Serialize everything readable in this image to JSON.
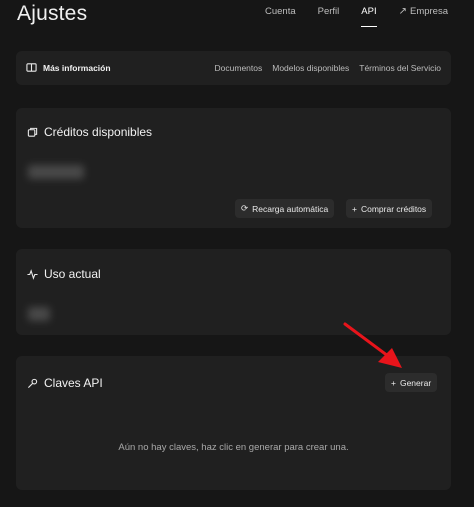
{
  "header": {
    "title": "Ajustes",
    "tabs": [
      {
        "label": "Cuenta"
      },
      {
        "label": "Perfil"
      },
      {
        "label": "API"
      },
      {
        "label": "Empresa"
      }
    ]
  },
  "info_bar": {
    "label": "Más información",
    "links": [
      "Documentos",
      "Modelos disponibles",
      "Términos del Servicio"
    ]
  },
  "credits": {
    "title": "Créditos disponibles",
    "auto_recharge_label": "Recarga automática",
    "buy_label": "Comprar créditos"
  },
  "usage": {
    "title": "Uso actual"
  },
  "keys": {
    "title": "Claves API",
    "generate_label": "Generar",
    "empty_message": "Aún no hay claves, haz clic en generar para crear una."
  },
  "colors": {
    "background": "#161616",
    "card": "#202020",
    "annotation_arrow": "#e8141b"
  }
}
